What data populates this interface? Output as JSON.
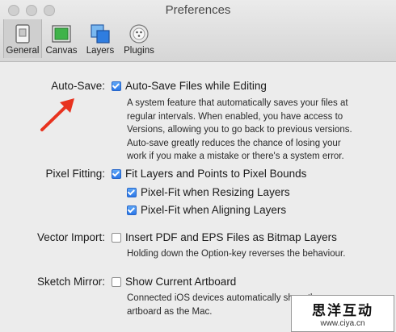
{
  "window": {
    "title": "Preferences"
  },
  "tabs": [
    {
      "label": "General",
      "icon": "general-panel-icon",
      "active": true
    },
    {
      "label": "Canvas",
      "icon": "canvas-icon",
      "active": false
    },
    {
      "label": "Layers",
      "icon": "layers-icon",
      "active": false
    },
    {
      "label": "Plugins",
      "icon": "plugins-icon",
      "active": false
    }
  ],
  "autosave": {
    "label": "Auto-Save:",
    "option": "Auto-Save Files while Editing",
    "checked": true,
    "description": [
      "A system feature that automatically saves your files at",
      "regular intervals. When enabled, you have access to",
      "Versions, allowing you to go back to previous versions.",
      "Auto-save greatly reduces the chance of losing your",
      "work if you make a mistake or there's a system error."
    ]
  },
  "pixel_fitting": {
    "label": "Pixel Fitting:",
    "option": "Fit Layers and Points to Pixel Bounds",
    "checked": true,
    "sub_options": [
      {
        "label": "Pixel-Fit when Resizing Layers",
        "checked": true
      },
      {
        "label": "Pixel-Fit when Aligning Layers",
        "checked": true
      }
    ]
  },
  "vector_import": {
    "label": "Vector Import:",
    "option": "Insert PDF and EPS Files as Bitmap Layers",
    "checked": false,
    "description": "Holding down the Option-key reverses the behaviour."
  },
  "sketch_mirror": {
    "label": "Sketch Mirror:",
    "option": "Show Current Artboard",
    "checked": false,
    "description": [
      "Connected iOS devices automatically show the",
      "artboard as the Mac."
    ]
  },
  "watermark": {
    "text": "思洋互动",
    "url": "www.ciya.cn"
  },
  "colors": {
    "accent": "#2c78e8",
    "arrow": "#e8321e",
    "window_bg": "#ececec"
  }
}
